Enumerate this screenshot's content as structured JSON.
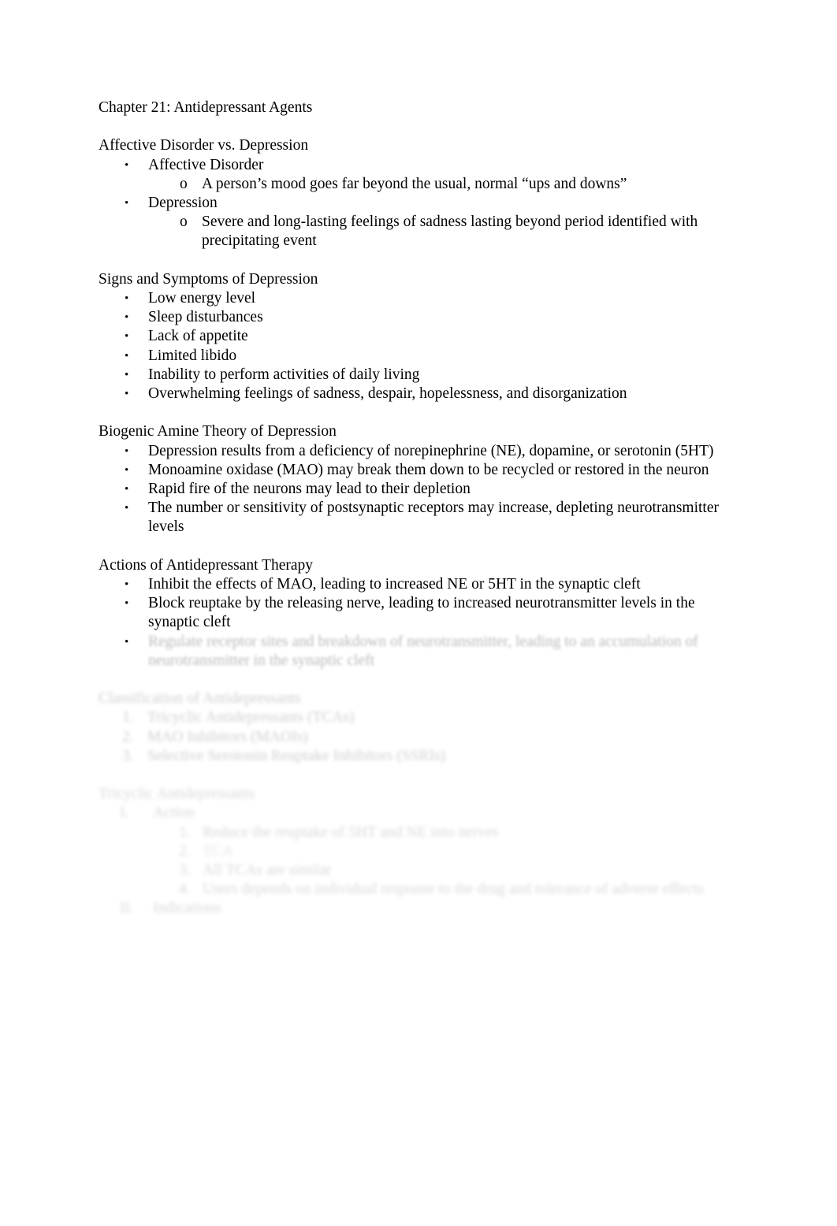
{
  "document": {
    "title": "Chapter 21: Antidepressant Agents",
    "markers": {
      "bullet": "•",
      "circle": "o",
      "roman_1": "I.",
      "roman_2": "II.",
      "num_1": "1.",
      "num_2": "2.",
      "num_3": "3.",
      "num_4": "4."
    },
    "sections": [
      {
        "heading": "Affective Disorder vs. Depression",
        "items": [
          {
            "level": 1,
            "text": "Affective Disorder"
          },
          {
            "level": 2,
            "text": "A person’s mood goes far beyond the usual, normal “ups and downs”"
          },
          {
            "level": 1,
            "text": "Depression"
          },
          {
            "level": 2,
            "text": "Severe and long-lasting feelings of sadness lasting beyond period identified with precipitating event"
          }
        ]
      },
      {
        "heading": "Signs and Symptoms of Depression",
        "items": [
          {
            "level": 1,
            "text": "Low energy level"
          },
          {
            "level": 1,
            "text": "Sleep disturbances"
          },
          {
            "level": 1,
            "text": "Lack of appetite"
          },
          {
            "level": 1,
            "text": "Limited libido"
          },
          {
            "level": 1,
            "text": "Inability to perform activities of daily living"
          },
          {
            "level": 1,
            "text": "Overwhelming feelings of sadness, despair, hopelessness, and disorganization"
          }
        ]
      },
      {
        "heading": "Biogenic Amine Theory of Depression",
        "items": [
          {
            "level": 1,
            "text": "Depression results from a deficiency of norepinephrine (NE), dopamine, or serotonin (5HT)"
          },
          {
            "level": 1,
            "text": "Monoamine oxidase (MAO) may break them down to be recycled or restored in the neuron"
          },
          {
            "level": 1,
            "text": "Rapid fire of the neurons may lead to their depletion"
          },
          {
            "level": 1,
            "text": "The number or sensitivity of postsynaptic receptors may increase, depleting neurotransmitter levels"
          }
        ]
      },
      {
        "heading": "Actions of Antidepressant Therapy",
        "items": [
          {
            "level": 1,
            "text": "Inhibit the effects of MAO, leading to increased NE or 5HT in the synaptic cleft"
          },
          {
            "level": 1,
            "text": "Block reuptake by the releasing nerve, leading to increased neurotransmitter levels in the synaptic cleft"
          },
          {
            "level": 1,
            "text": "Regulate receptor sites and breakdown of neurotransmitter, leading to an accumulation of neurotransmitter in the synaptic cleft"
          }
        ]
      },
      {
        "heading": "Classification of Antidepressants",
        "items": [
          {
            "level": 1,
            "text": "Tricyclic Antidepressants (TCAs)"
          },
          {
            "level": 1,
            "text": "MAO Inhibitors (MAOIs)"
          },
          {
            "level": 1,
            "text": "Selective Serotonin Reuptake Inhibitors (SSRIs)"
          }
        ]
      },
      {
        "heading": "Tricyclic Antidepressants",
        "items": [
          {
            "level": 1,
            "text": "Action"
          },
          {
            "level": 2,
            "text": "Reduce the reuptake of 5HT and NE into nerves"
          },
          {
            "level": 2,
            "text": "TCA"
          },
          {
            "level": 2,
            "text": "All TCAs are similar"
          },
          {
            "level": 2,
            "text": "Users depends on individual response to the drug and tolerance of adverse effects"
          },
          {
            "level": 1,
            "text": "Indications"
          }
        ]
      }
    ]
  }
}
